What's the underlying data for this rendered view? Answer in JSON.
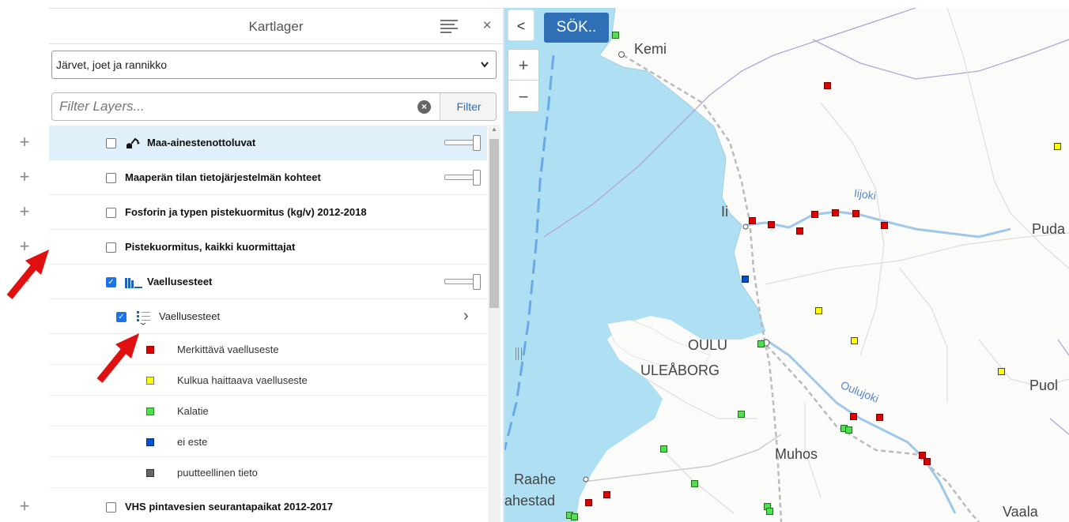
{
  "panel": {
    "title": "Kartlager",
    "close_label": "×"
  },
  "category_select": {
    "value": "Järvet, joet ja rannikko"
  },
  "filter": {
    "placeholder": "Filter Layers...",
    "button_label": "Filter",
    "clear_label": "×"
  },
  "layers": [
    {
      "name": "Maa-ainestenottoluvat",
      "expander": "+",
      "checked": false
    },
    {
      "name": "Maaperän tilan tietojärjestelmän kohteet",
      "expander": "+",
      "checked": false
    },
    {
      "name": "Fosforin ja typen pistekuormitus (kg/v) 2012-2018",
      "expander": "+",
      "checked": false
    },
    {
      "name": "Pistekuormitus, kaikki kuormittajat",
      "expander": "+",
      "checked": false
    },
    {
      "name": "Vaellusesteet",
      "expander": "−",
      "checked": true
    },
    {
      "name": "VHS pintavesien seurantapaikat 2012-2017",
      "expander": "+",
      "checked": false
    }
  ],
  "sublayer": {
    "name": "Vaellusesteet",
    "checked": true,
    "chevron": "›"
  },
  "legend": [
    {
      "label": "Merkittävä vaelluseste",
      "color": "#e00000"
    },
    {
      "label": "Kulkua haittaava vaelluseste",
      "color": "#ffff00"
    },
    {
      "label": "Kalatie",
      "color": "#4fe04f"
    },
    {
      "label": "ei este",
      "color": "#0050d0"
    },
    {
      "label": "puutteellinen tieto",
      "color": "#666666"
    }
  ],
  "map": {
    "search_label": "SÖK..",
    "collapse_label": "<",
    "zoom_in_label": "+",
    "zoom_out_label": "−",
    "places": [
      "Kemi",
      "Ii",
      "Pudа",
      "OULU",
      "ULEÅBORG",
      "Puol",
      "Muhos",
      "Raahe",
      "ahestad",
      "Vaala"
    ],
    "rivers": [
      "Iijoki",
      "Oulujoki"
    ],
    "sea_color": "#aedff2",
    "land_color": "#fbfbfa"
  }
}
